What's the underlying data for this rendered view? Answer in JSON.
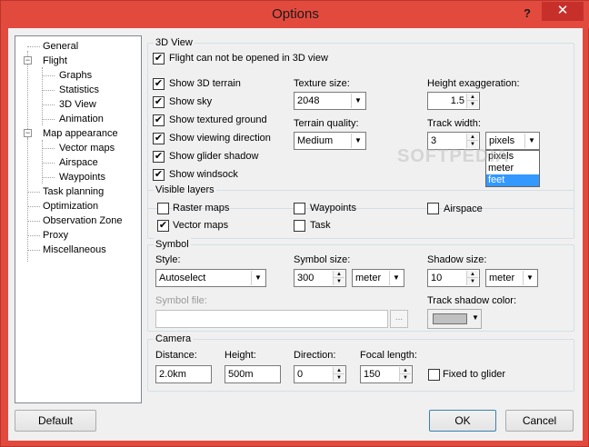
{
  "window": {
    "title": "Options",
    "help_glyph": "?",
    "close_glyph": "✕"
  },
  "tree": {
    "items": [
      {
        "label": "General"
      },
      {
        "label": "Flight"
      },
      {
        "label": "Graphs"
      },
      {
        "label": "Statistics"
      },
      {
        "label": "3D View"
      },
      {
        "label": "Animation"
      },
      {
        "label": "Map appearance"
      },
      {
        "label": "Vector maps"
      },
      {
        "label": "Airspace"
      },
      {
        "label": "Waypoints"
      },
      {
        "label": "Task planning"
      },
      {
        "label": "Optimization"
      },
      {
        "label": "Observation Zone"
      },
      {
        "label": "Proxy"
      },
      {
        "label": "Miscellaneous"
      }
    ],
    "expander_minus": "−"
  },
  "view3d": {
    "group_title": "3D View",
    "cant_open_label": "Flight can not be opened in 3D view",
    "checks": [
      {
        "label": "Show 3D terrain",
        "checked": true
      },
      {
        "label": "Show sky",
        "checked": true
      },
      {
        "label": "Show textured ground",
        "checked": true
      },
      {
        "label": "Show viewing direction",
        "checked": true
      },
      {
        "label": "Show glider shadow",
        "checked": true
      },
      {
        "label": "Show windsock",
        "checked": true
      }
    ],
    "texture_size_label": "Texture size:",
    "texture_size_value": "2048",
    "terrain_quality_label": "Terrain quality:",
    "terrain_quality_value": "Medium",
    "height_exag_label": "Height exaggeration:",
    "height_exag_value": "1.5",
    "track_width_label": "Track width:",
    "track_width_value": "3",
    "track_unit_value": "pixels",
    "track_unit_options": [
      "pixels",
      "meter",
      "feet"
    ],
    "track_unit_highlighted": "feet"
  },
  "layers": {
    "group_title": "Visible layers",
    "items": [
      {
        "label": "Raster maps",
        "checked": false
      },
      {
        "label": "Waypoints",
        "checked": false
      },
      {
        "label": "Airspace",
        "checked": false
      },
      {
        "label": "Vector maps",
        "checked": true
      },
      {
        "label": "Task",
        "checked": false
      }
    ]
  },
  "symbol": {
    "group_title": "Symbol",
    "style_label": "Style:",
    "style_value": "Autoselect",
    "size_label": "Symbol size:",
    "size_value": "300",
    "size_unit": "meter",
    "shadow_label": "Shadow size:",
    "shadow_value": "10",
    "shadow_unit": "meter",
    "file_label": "Symbol file:",
    "file_value": "",
    "browse_label": "...",
    "track_shadow_label": "Track shadow color:",
    "track_shadow_color": "#c0c0c0"
  },
  "camera": {
    "group_title": "Camera",
    "distance_label": "Distance:",
    "distance_value": "2.0km",
    "height_label": "Height:",
    "height_value": "500m",
    "direction_label": "Direction:",
    "direction_value": "0",
    "focal_label": "Focal length:",
    "focal_value": "150",
    "fixed_label": "Fixed to glider",
    "fixed_checked": false
  },
  "buttons": {
    "default": "Default",
    "ok": "OK",
    "cancel": "Cancel"
  },
  "watermark": "SOFTPEDIA",
  "icons": {
    "check": "✔",
    "arrow_down": "▼",
    "arrow_up": "▲"
  }
}
